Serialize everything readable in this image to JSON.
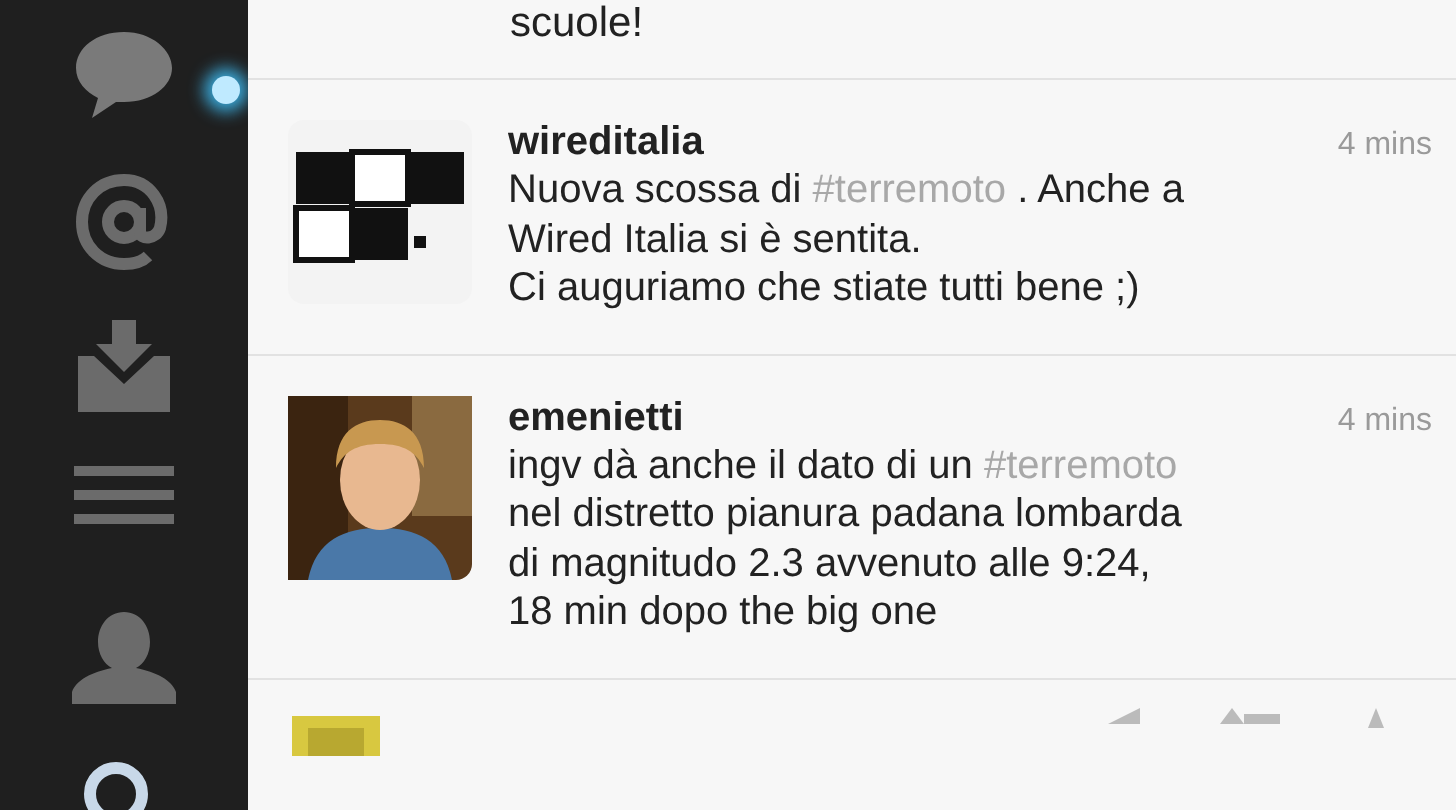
{
  "sidebar": {
    "items": [
      {
        "kind": "chat",
        "selected": true
      },
      {
        "kind": "mention",
        "selected": false
      },
      {
        "kind": "inbox",
        "selected": false
      },
      {
        "kind": "lists",
        "selected": false
      },
      {
        "kind": "profile",
        "selected": false
      },
      {
        "kind": "search",
        "selected": false
      }
    ]
  },
  "timeline": {
    "partial_top": {
      "text": "scuole!"
    },
    "tweets": [
      {
        "user": "wireditalia",
        "time": "4 mins",
        "lines": [
          [
            {
              "kind": "plain",
              "text": "Nuova scossa di "
            },
            {
              "kind": "hashtag",
              "text": "#terremoto"
            },
            {
              "kind": "plain",
              "text": " . Anche a"
            }
          ],
          [
            {
              "kind": "plain",
              "text": "Wired Italia si è sentita."
            }
          ],
          [
            {
              "kind": "plain",
              "text": "Ci auguriamo che stiate tutti bene ;)"
            }
          ]
        ]
      },
      {
        "user": "emenietti",
        "time": "4 mins",
        "lines": [
          [
            {
              "kind": "plain",
              "text": "ingv dà anche il dato di un "
            },
            {
              "kind": "hashtag",
              "text": "#terremoto"
            }
          ],
          [
            {
              "kind": "plain",
              "text": "nel distretto pianura padana lombarda"
            }
          ],
          [
            {
              "kind": "plain",
              "text": "di magnitudo  2.3 avvenuto alle 9:24,"
            }
          ],
          [
            {
              "kind": "plain",
              "text": "18 min dopo the big one"
            }
          ]
        ]
      }
    ]
  }
}
